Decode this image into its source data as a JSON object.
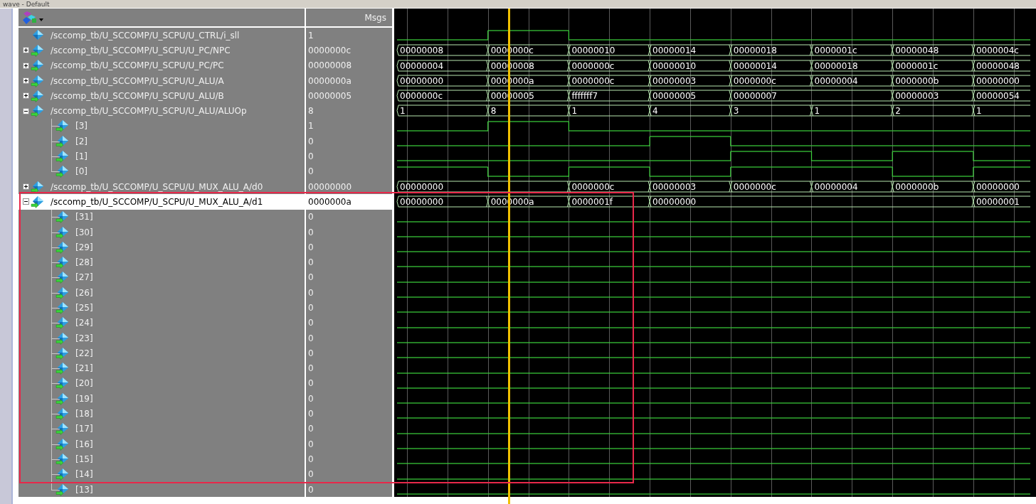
{
  "window": {
    "title": "wave - Default"
  },
  "header": {
    "values_column": "Msgs"
  },
  "signals": [
    {
      "name": "/sccomp_tb/U_SCCOMP/U_SCPU/U_CTRL/i_sll",
      "value": "1",
      "kind": "bit",
      "selected": false,
      "wave": {
        "high": [
          false,
          true,
          false,
          false,
          false,
          false,
          false,
          false
        ]
      }
    },
    {
      "name": "/sccomp_tb/U_SCCOMP/U_SCPU/U_PC/NPC",
      "value": "0000000c",
      "kind": "bus",
      "expanded": false,
      "selected": false,
      "wave": {
        "segments": [
          "00000008",
          "0000000c",
          "00000010",
          "00000014",
          "00000018",
          "0000001c",
          "00000048",
          "0000004c"
        ]
      }
    },
    {
      "name": "/sccomp_tb/U_SCCOMP/U_SCPU/U_PC/PC",
      "value": "00000008",
      "kind": "bus",
      "expanded": false,
      "selected": false,
      "wave": {
        "segments": [
          "00000004",
          "00000008",
          "0000000c",
          "00000010",
          "00000014",
          "00000018",
          "0000001c",
          "00000048"
        ]
      }
    },
    {
      "name": "/sccomp_tb/U_SCCOMP/U_SCPU/U_ALU/A",
      "value": "0000000a",
      "kind": "bus",
      "expanded": false,
      "selected": false,
      "wave": {
        "segments": [
          "00000000",
          "0000000a",
          "0000000c",
          "00000003",
          "0000000c",
          "00000004",
          "0000000b",
          "00000000"
        ]
      }
    },
    {
      "name": "/sccomp_tb/U_SCCOMP/U_SCPU/U_ALU/B",
      "value": "00000005",
      "kind": "bus",
      "expanded": false,
      "selected": false,
      "wave": {
        "segments": [
          {
            "kind": "change",
            "value": "0000000c"
          },
          {
            "kind": "change",
            "value": "00000005"
          },
          {
            "kind": "change",
            "value": "fffffff7"
          },
          {
            "kind": "change",
            "value": "00000005"
          },
          {
            "kind": "change",
            "value": "00000007"
          },
          {
            "kind": "hold"
          },
          {
            "kind": "change",
            "value": "00000003"
          },
          {
            "kind": "change",
            "value": "00000054"
          }
        ]
      }
    },
    {
      "name": "/sccomp_tb/U_SCCOMP/U_SCPU/U_ALU/ALUOp",
      "value": "8",
      "kind": "bus",
      "expanded": true,
      "selected": false,
      "wave": {
        "segments": [
          "1",
          "8",
          "1",
          "4",
          "3",
          "1",
          "2",
          "1"
        ]
      },
      "children": [
        {
          "name": "[3]",
          "value": "1",
          "kind": "bit",
          "selected": false,
          "wave": {
            "high": [
              false,
              true,
              false,
              false,
              false,
              false,
              false,
              false
            ]
          }
        },
        {
          "name": "[2]",
          "value": "0",
          "kind": "bit",
          "selected": false,
          "wave": {
            "high": [
              false,
              false,
              false,
              true,
              false,
              false,
              false,
              false
            ]
          }
        },
        {
          "name": "[1]",
          "value": "0",
          "kind": "bit",
          "selected": false,
          "wave": {
            "high": [
              false,
              false,
              false,
              false,
              true,
              false,
              true,
              false
            ]
          }
        },
        {
          "name": "[0]",
          "value": "0",
          "kind": "bit",
          "selected": false,
          "wave": {
            "high": [
              true,
              false,
              true,
              false,
              true,
              true,
              false,
              true
            ]
          }
        }
      ]
    },
    {
      "name": "/sccomp_tb/U_SCCOMP/U_SCPU/U_MUX_ALU_A/d0",
      "value": "00000000",
      "kind": "bus",
      "expanded": false,
      "selected": false,
      "wave": {
        "segments": [
          {
            "kind": "change",
            "value": "00000000"
          },
          {
            "kind": "hold"
          },
          {
            "kind": "change",
            "value": "0000000c"
          },
          {
            "kind": "change",
            "value": "00000003"
          },
          {
            "kind": "change",
            "value": "0000000c"
          },
          {
            "kind": "change",
            "value": "00000004"
          },
          {
            "kind": "change",
            "value": "0000000b"
          },
          {
            "kind": "change",
            "value": "00000000"
          }
        ]
      }
    },
    {
      "name": "/sccomp_tb/U_SCCOMP/U_SCPU/U_MUX_ALU_A/d1",
      "value": "0000000a",
      "kind": "bus",
      "expanded": true,
      "selected": true,
      "wave": {
        "segments": [
          {
            "kind": "change",
            "value": "00000000"
          },
          {
            "kind": "change",
            "value": "0000000a"
          },
          {
            "kind": "change",
            "value": "0000001f"
          },
          {
            "kind": "change",
            "value": "00000000"
          },
          {
            "kind": "hold"
          },
          {
            "kind": "hold"
          },
          {
            "kind": "hold"
          },
          {
            "kind": "change",
            "value": "00000001"
          }
        ]
      },
      "children": [
        {
          "name": "[31]",
          "value": "0",
          "kind": "bit",
          "selected": false,
          "wave": {
            "high": [
              false,
              false,
              false,
              false,
              false,
              false,
              false,
              false
            ]
          }
        },
        {
          "name": "[30]",
          "value": "0",
          "kind": "bit",
          "selected": false,
          "wave": {
            "high": [
              false,
              false,
              false,
              false,
              false,
              false,
              false,
              false
            ]
          }
        },
        {
          "name": "[29]",
          "value": "0",
          "kind": "bit",
          "selected": false,
          "wave": {
            "high": [
              false,
              false,
              false,
              false,
              false,
              false,
              false,
              false
            ]
          }
        },
        {
          "name": "[28]",
          "value": "0",
          "kind": "bit",
          "selected": false,
          "wave": {
            "high": [
              false,
              false,
              false,
              false,
              false,
              false,
              false,
              false
            ]
          }
        },
        {
          "name": "[27]",
          "value": "0",
          "kind": "bit",
          "selected": false,
          "wave": {
            "high": [
              false,
              false,
              false,
              false,
              false,
              false,
              false,
              false
            ]
          }
        },
        {
          "name": "[26]",
          "value": "0",
          "kind": "bit",
          "selected": false,
          "wave": {
            "high": [
              false,
              false,
              false,
              false,
              false,
              false,
              false,
              false
            ]
          }
        },
        {
          "name": "[25]",
          "value": "0",
          "kind": "bit",
          "selected": false,
          "wave": {
            "high": [
              false,
              false,
              false,
              false,
              false,
              false,
              false,
              false
            ]
          }
        },
        {
          "name": "[24]",
          "value": "0",
          "kind": "bit",
          "selected": false,
          "wave": {
            "high": [
              false,
              false,
              false,
              false,
              false,
              false,
              false,
              false
            ]
          }
        },
        {
          "name": "[23]",
          "value": "0",
          "kind": "bit",
          "selected": false,
          "wave": {
            "high": [
              false,
              false,
              false,
              false,
              false,
              false,
              false,
              false
            ]
          }
        },
        {
          "name": "[22]",
          "value": "0",
          "kind": "bit",
          "selected": false,
          "wave": {
            "high": [
              false,
              false,
              false,
              false,
              false,
              false,
              false,
              false
            ]
          }
        },
        {
          "name": "[21]",
          "value": "0",
          "kind": "bit",
          "selected": false,
          "wave": {
            "high": [
              false,
              false,
              false,
              false,
              false,
              false,
              false,
              false
            ]
          }
        },
        {
          "name": "[20]",
          "value": "0",
          "kind": "bit",
          "selected": false,
          "wave": {
            "high": [
              false,
              false,
              false,
              false,
              false,
              false,
              false,
              false
            ]
          }
        },
        {
          "name": "[19]",
          "value": "0",
          "kind": "bit",
          "selected": false,
          "wave": {
            "high": [
              false,
              false,
              false,
              false,
              false,
              false,
              false,
              false
            ]
          }
        },
        {
          "name": "[18]",
          "value": "0",
          "kind": "bit",
          "selected": false,
          "wave": {
            "high": [
              false,
              false,
              false,
              false,
              false,
              false,
              false,
              false
            ]
          }
        },
        {
          "name": "[17]",
          "value": "0",
          "kind": "bit",
          "selected": false,
          "wave": {
            "high": [
              false,
              false,
              false,
              false,
              false,
              false,
              false,
              false
            ]
          }
        },
        {
          "name": "[16]",
          "value": "0",
          "kind": "bit",
          "selected": false,
          "wave": {
            "high": [
              false,
              false,
              false,
              false,
              false,
              false,
              false,
              false
            ]
          }
        },
        {
          "name": "[15]",
          "value": "0",
          "kind": "bit",
          "selected": false,
          "wave": {
            "high": [
              false,
              false,
              false,
              false,
              false,
              false,
              false,
              false
            ]
          }
        },
        {
          "name": "[14]",
          "value": "0",
          "kind": "bit",
          "selected": false,
          "wave": {
            "high": [
              false,
              false,
              false,
              false,
              false,
              false,
              false,
              false
            ]
          }
        },
        {
          "name": "[13]",
          "value": "0",
          "kind": "bit",
          "selected": false,
          "wave": {
            "high": [
              false,
              false,
              false,
              false,
              false,
              false,
              false,
              false
            ]
          }
        }
      ]
    }
  ]
}
